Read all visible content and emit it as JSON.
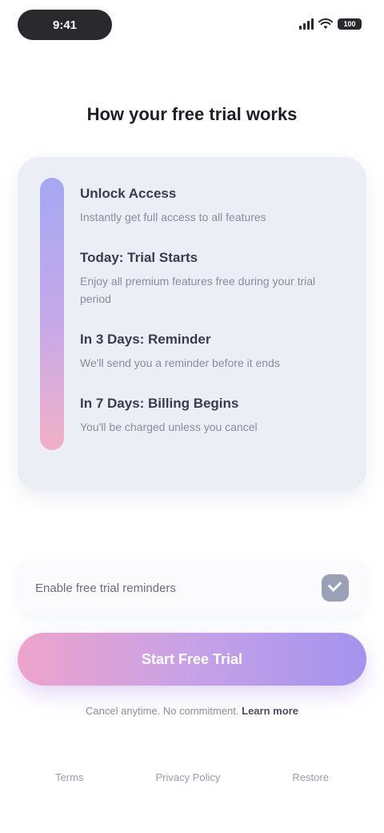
{
  "status_bar": {
    "time": "9:41",
    "battery": "100"
  },
  "title": "How your free trial works",
  "plan": {
    "items": [
      {
        "title": "Unlock Access",
        "desc": "Instantly get full access to all features"
      },
      {
        "title": "Today: Trial Starts",
        "desc": "Enjoy all premium features free during your trial period"
      },
      {
        "title": "In 3 Days: Reminder",
        "desc": "We'll send you a reminder before it ends"
      },
      {
        "title": "In 7 Days: Billing Begins",
        "desc": "You'll be charged unless you cancel"
      }
    ]
  },
  "promo": {
    "label": "Enable free trial reminders"
  },
  "cta": {
    "label": "Start Free Trial"
  },
  "terms": {
    "text": "Cancel anytime. No commitment.",
    "link": "Learn more"
  },
  "footer": {
    "links": [
      "Terms",
      "Privacy Policy",
      "Restore"
    ]
  },
  "colors": {
    "card_bg": "#eceef6",
    "cta_start": "#eda4cc",
    "cta_end": "#a393ee"
  }
}
